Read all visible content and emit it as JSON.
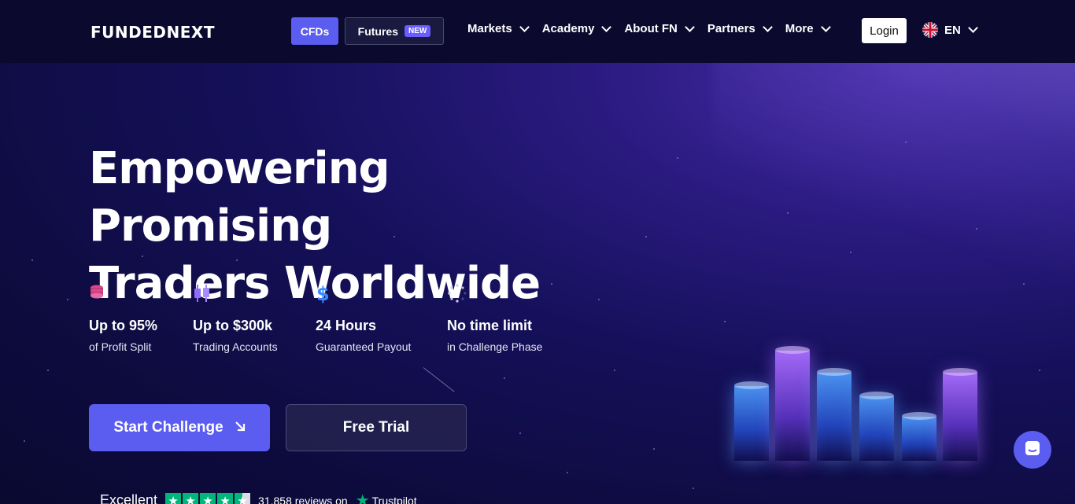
{
  "header": {
    "logo": "FUNDEDNEXT",
    "tabs": [
      {
        "label": "CFDs"
      },
      {
        "label": "Futures",
        "badge": "NEW"
      }
    ],
    "nav": [
      {
        "label": "Markets"
      },
      {
        "label": "Academy"
      },
      {
        "label": "About FN"
      },
      {
        "label": "Partners"
      },
      {
        "label": "More"
      }
    ],
    "login_label": "Login",
    "language": "EN"
  },
  "hero": {
    "headline_line1": "Empowering Promising",
    "headline_line2": "Traders Worldwide",
    "features": [
      {
        "icon": "coins-stack-icon",
        "title": "Up to 95%",
        "subtitle": "of Profit Split"
      },
      {
        "icon": "candlestick-icon",
        "title": "Up to $300k",
        "subtitle": "Trading Accounts"
      },
      {
        "icon": "dollar-icon",
        "title": "24 Hours",
        "subtitle": "Guaranteed Payout"
      },
      {
        "icon": "loading-spinner-icon",
        "title": "No time limit",
        "subtitle": "in Challenge Phase"
      }
    ],
    "start_button": "Start Challenge",
    "free_button": "Free Trial"
  },
  "trustpilot": {
    "rating_text": "Excellent",
    "stars": 4.5,
    "reviews": "31,858 reviews on",
    "brand": "Trustpilot"
  },
  "colors": {
    "accent": "#5b5cf0",
    "header_bg": "#0b0a2e",
    "trust_green": "#00b67a"
  }
}
